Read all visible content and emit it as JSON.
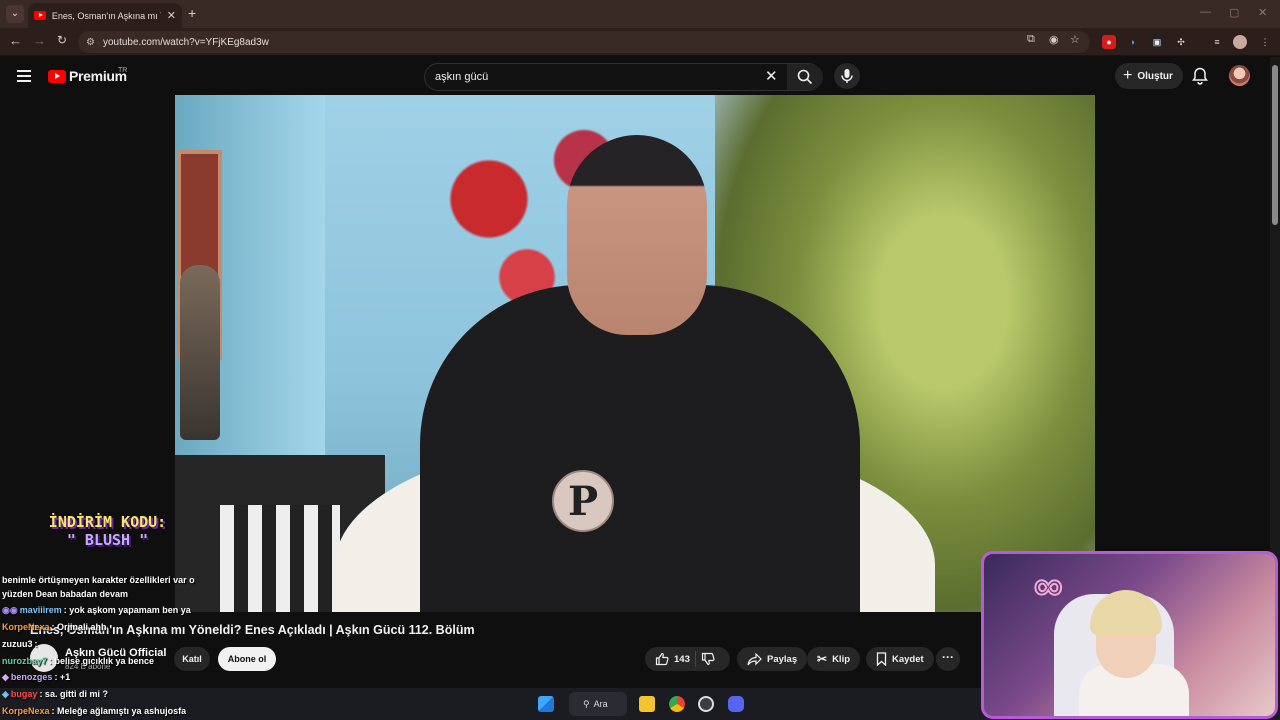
{
  "browser": {
    "tab_title": "Enes, Osman'ın Aşkına mı Yöneldi?",
    "url": "youtube.com/watch?v=YFjKEg8ad3w"
  },
  "masthead": {
    "logo_text": "Premium",
    "country_code": "TR",
    "search_value": "aşkın gücü",
    "create_label": "Oluştur"
  },
  "video": {
    "title": "Enes, Osman'ın Aşkına mı Yöneldi? Enes Açıkladı | Aşkın Gücü 112. Bölüm",
    "channel": "Aşkın Gücü Official",
    "subscribers": "824 B abone",
    "join_label": "Katıl",
    "subscribe_label": "Abone ol",
    "likes": "143",
    "share_label": "Paylaş",
    "clip_label": "Klip",
    "save_label": "Kaydet"
  },
  "promo": {
    "line1": "İNDİRİM KODU:",
    "line2": "\" BLUSH \""
  },
  "chat": {
    "frag1": "benimle örtüşmeyen karakter özellikleri var o",
    "frag2": "yüzden Dean babadan devam",
    "m1_user": "maviiirem",
    "m1_text": ": yok aşkom yapamam ben ya",
    "m2_user": "KorpeNexa",
    "m2_text": ": Orjinali ahh",
    "m3_user": "zuzuu3",
    "m3_text": ":",
    "m4_user": "nurozbay7",
    "m4_text": ": belise gıcıklık ya bence",
    "m5_user": "benozges",
    "m5_text": ": +1",
    "m6_user": "bugay",
    "m6_text": ": sa. gitti di mi ?",
    "m7_user": "KorpeNexa",
    "m7_text": ": Meleğe ağlamıştı ya ashujosfa"
  },
  "taskbar": {
    "search_label": "Ara"
  },
  "colors": {
    "youtube_red": "#ff0000",
    "chrome_tab": "#3a2a26",
    "webcam_border": "#b85cd6"
  }
}
